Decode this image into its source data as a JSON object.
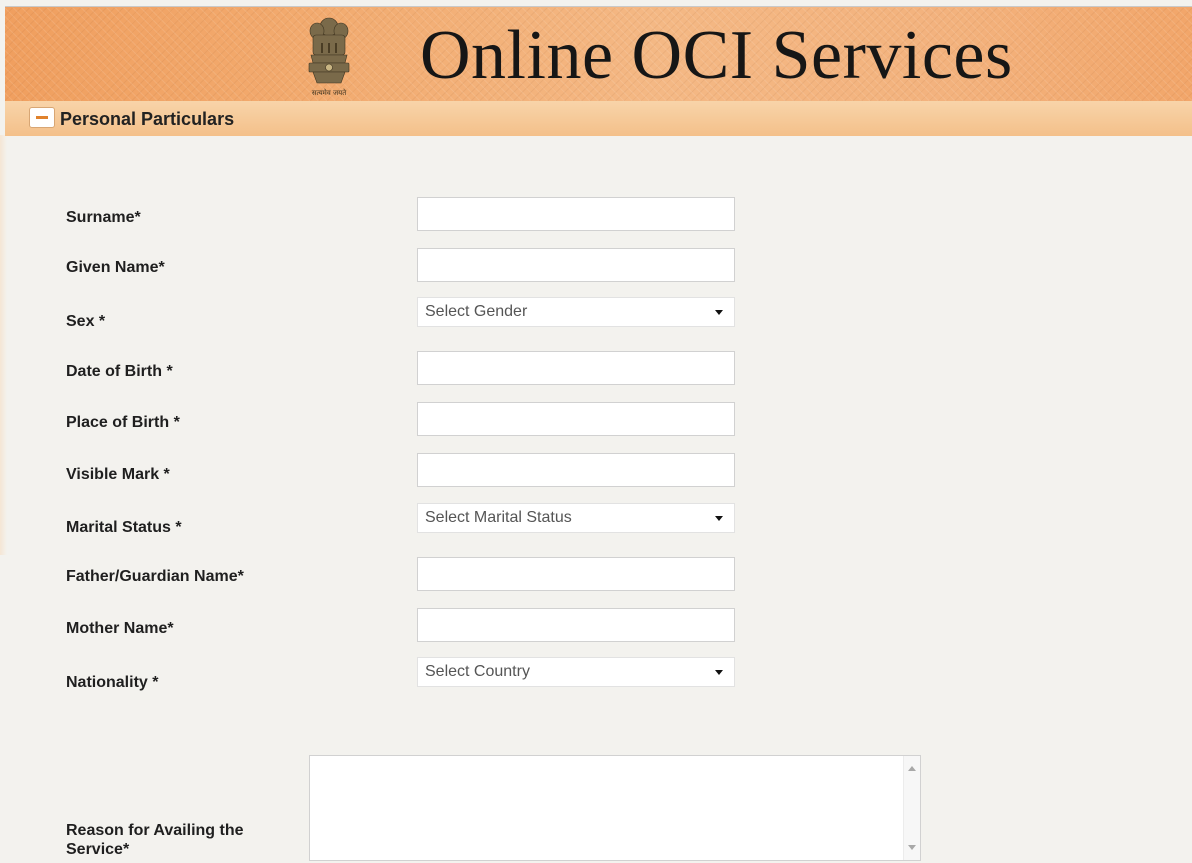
{
  "header": {
    "title": "Online OCI Services",
    "emblem_icon": "emblem-icon",
    "emblem_caption": "सत्यमेव जयते"
  },
  "section": {
    "title": "Personal Particulars",
    "toggle_icon": "minus-icon"
  },
  "form": {
    "surname_label": "Surname*",
    "given_name_label": "Given Name*",
    "sex_label": "Sex *",
    "sex_select_value": "Select Gender",
    "dob_label": "Date of Birth *",
    "pob_label": "Place of Birth *",
    "visible_mark_label": "Visible Mark *",
    "marital_label": "Marital Status *",
    "marital_select_value": "Select Marital Status",
    "father_label": "Father/Guardian Name*",
    "mother_label": "Mother Name*",
    "nationality_label": "Nationality *",
    "nationality_select_value": "Select Country",
    "reason_label": "Reason for Availing the Service*"
  },
  "colors": {
    "banner_orange": "#f2aa6e",
    "section_bar": "#f4c08a",
    "page_bg": "#f3f2ee",
    "toggle_accent": "#e0822c"
  }
}
